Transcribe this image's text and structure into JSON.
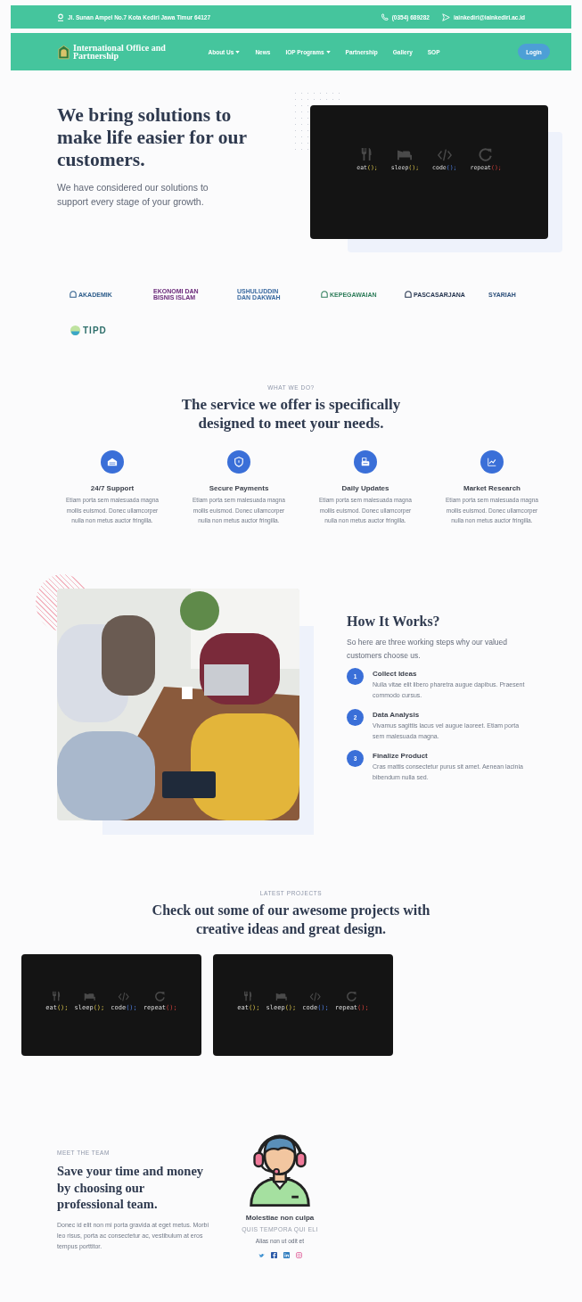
{
  "top_bar": {
    "address": "Jl. Sunan Ampel No.7 Kota Kediri Jawa Timur 64127",
    "phone": "(0354) 689282",
    "email": "iainkediri@iainkediri.ac.id"
  },
  "nav": {
    "brand": "International Office and Partnership",
    "items": [
      {
        "label": "About Us",
        "dropdown": true
      },
      {
        "label": "News",
        "dropdown": false
      },
      {
        "label": "IOP Programs",
        "dropdown": true
      },
      {
        "label": "Partnership",
        "dropdown": false
      },
      {
        "label": "Gallery",
        "dropdown": false
      },
      {
        "label": "SOP",
        "dropdown": false
      }
    ],
    "login": "Login"
  },
  "hero": {
    "title": "We bring solutions to make life easier for our customers.",
    "subtitle": "We have considered our solutions to support every stage of your growth.",
    "code_banner": [
      {
        "word": "eat",
        "punct": "();"
      },
      {
        "word": "sleep",
        "punct": "();"
      },
      {
        "word": "code",
        "punct": "();"
      },
      {
        "word": "repeat",
        "punct": "();"
      }
    ]
  },
  "partner_logos": [
    {
      "text": "AKADEMIK",
      "kind": "mosque",
      "color": "#2c5c8a"
    },
    {
      "text": "EKONOMI DAN BISNIS ISLAM",
      "kind": "plain",
      "color": "#6b2a7a"
    },
    {
      "text": "USHULUDDIN DAN DAKWAH",
      "kind": "plain",
      "color": "#3a6aa0"
    },
    {
      "text": "KEPEGAWAIAN",
      "kind": "mosque",
      "color": "#2e7d5a"
    },
    {
      "text": "PASCASARJANA",
      "kind": "mosque",
      "color": "#1f2f4a"
    },
    {
      "text": "SYARIAH",
      "kind": "plain",
      "color": "#2c4f7a"
    },
    {
      "text": "TIPD",
      "kind": "swirl",
      "color": "#2d6e6a"
    }
  ],
  "services": {
    "eyebrow": "WHAT WE DO?",
    "title": "The service we offer is specifically designed to meet your needs.",
    "items": [
      {
        "title": "24/7 Support",
        "text": "Etiam porta sem malesuada magna mollis euismod. Donec ullamcorper nulla non metus auctor fringilla."
      },
      {
        "title": "Secure Payments",
        "text": "Etiam porta sem malesuada magna mollis euismod. Donec ullamcorper nulla non metus auctor fringilla."
      },
      {
        "title": "Daily Updates",
        "text": "Etiam porta sem malesuada magna mollis euismod. Donec ullamcorper nulla non metus auctor fringilla."
      },
      {
        "title": "Market Research",
        "text": "Etiam porta sem malesuada magna mollis euismod. Donec ullamcorper nulla non metus auctor fringilla."
      }
    ]
  },
  "how_it_works": {
    "title": "How It Works?",
    "subtitle": "So here are three working steps why our valued customers choose us.",
    "steps": [
      {
        "number": "1",
        "title": "Collect Ideas",
        "text": "Nulla vitae elit libero pharetra augue dapibus. Praesent commodo cursus."
      },
      {
        "number": "2",
        "title": "Data Analysis",
        "text": "Vivamus sagittis lacus vel augue laoreet. Etiam porta sem malesuada magna."
      },
      {
        "number": "3",
        "title": "Finalize Product",
        "text": "Cras mattis consectetur purus sit amet. Aenean lacinia bibendum nulla sed."
      }
    ]
  },
  "projects": {
    "eyebrow": "LATEST PROJECTS",
    "title": "Check out some of our awesome projects with creative ideas and great design.",
    "cards": [
      {
        "code_banner": [
          {
            "word": "eat",
            "punct": "();"
          },
          {
            "word": "sleep",
            "punct": "();"
          },
          {
            "word": "code",
            "punct": "();"
          },
          {
            "word": "repeat",
            "punct": "();"
          }
        ]
      },
      {
        "code_banner": [
          {
            "word": "eat",
            "punct": "();"
          },
          {
            "word": "sleep",
            "punct": "();"
          },
          {
            "word": "code",
            "punct": "();"
          },
          {
            "word": "repeat",
            "punct": "();"
          }
        ]
      }
    ]
  },
  "team": {
    "eyebrow": "MEET THE TEAM",
    "title": "Save your time and money by choosing our professional team.",
    "text": "Donec id elit non mi porta gravida at eget metus. Morbi leo risus, porta ac consectetur ac, vestibulum at eros tempus porttitor.",
    "members": [
      {
        "name": "Molestiae non culpa",
        "role": "QUIS TEMPORA QUI ELI",
        "bio": "Alias non ut odit et"
      }
    ]
  }
}
